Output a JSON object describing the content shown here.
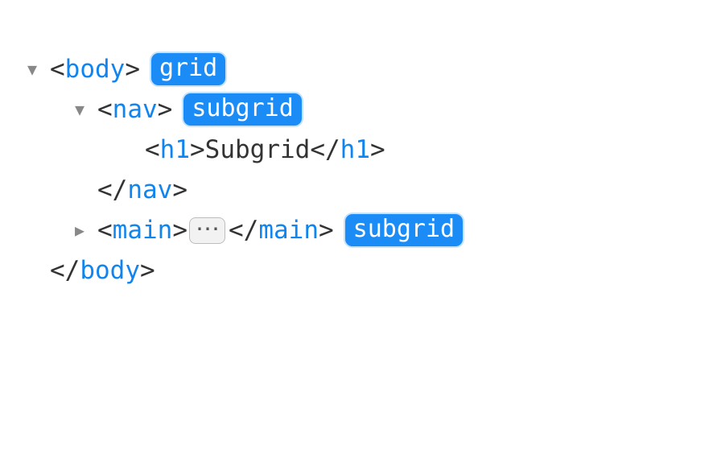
{
  "tree": {
    "body": {
      "open": "<",
      "tag": "body",
      "close": ">",
      "badge": "grid",
      "closeOpen": "</",
      "closeTag": "body",
      "closeClose": ">"
    },
    "nav": {
      "open": "<",
      "tag": "nav",
      "close": ">",
      "badge": "subgrid",
      "closeOpen": "</",
      "closeTag": "nav",
      "closeClose": ">"
    },
    "h1": {
      "open": "<",
      "tag": "h1",
      "close": ">",
      "text": "Subgrid",
      "closeOpen": "</",
      "closeTag": "h1",
      "closeClose": ">"
    },
    "main": {
      "open": "<",
      "tag": "main",
      "close": ">",
      "ellipsis": "⋯",
      "closeOpen": "</",
      "closeTag": "main",
      "closeClose": ">",
      "badge": "subgrid"
    }
  },
  "icons": {
    "down": "▼",
    "right": "▶"
  }
}
